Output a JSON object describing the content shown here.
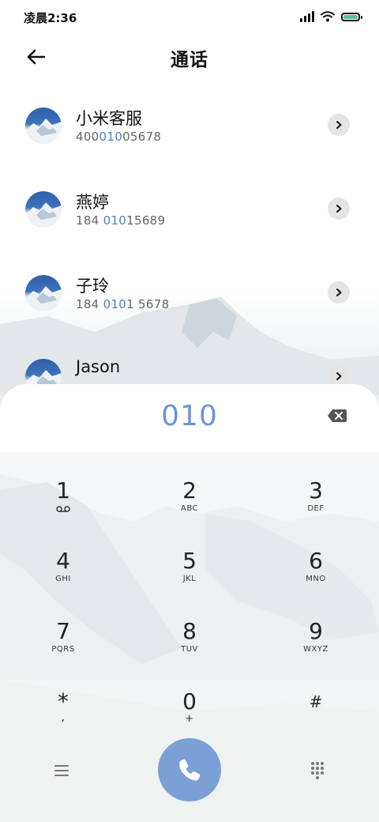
{
  "status": {
    "time": "凌晨2:36",
    "signal_icon": "signal-icon",
    "wifi_icon": "wifi-icon",
    "battery_icon": "battery-icon"
  },
  "header": {
    "title": "通话",
    "back_icon": "back-arrow-icon"
  },
  "contacts": [
    {
      "name": "小米客服",
      "number_parts": [
        "400",
        "010",
        "05678"
      ]
    },
    {
      "name": "燕婷",
      "number_parts": [
        "184 ",
        "010",
        "15689"
      ]
    },
    {
      "name": "子玲",
      "number_parts": [
        "184 ",
        "010",
        "1 5678"
      ]
    },
    {
      "name": "Jason",
      "number_parts": [
        "",
        "",
        ""
      ]
    }
  ],
  "dialer": {
    "entered": "010",
    "keys": [
      {
        "digit": "1",
        "letters": "voicemail-icon"
      },
      {
        "digit": "2",
        "letters": "ABC"
      },
      {
        "digit": "3",
        "letters": "DEF"
      },
      {
        "digit": "4",
        "letters": "GHI"
      },
      {
        "digit": "5",
        "letters": "JKL"
      },
      {
        "digit": "6",
        "letters": "MNO"
      },
      {
        "digit": "7",
        "letters": "PQRS"
      },
      {
        "digit": "8",
        "letters": "TUV"
      },
      {
        "digit": "9",
        "letters": "WXYZ"
      },
      {
        "digit": "*",
        "letters": ","
      },
      {
        "digit": "0",
        "letters": "+"
      },
      {
        "digit": "#",
        "letters": ""
      }
    ]
  },
  "colors": {
    "accent": "#4b7fc6",
    "entered": "#6b94d2",
    "call_button": "#7aa0d6"
  }
}
